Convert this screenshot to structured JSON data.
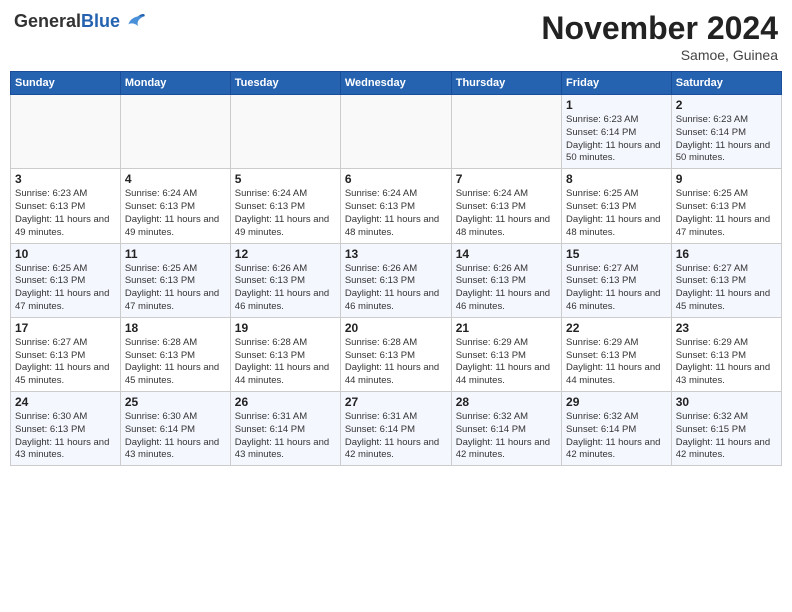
{
  "logo": {
    "general": "General",
    "blue": "Blue"
  },
  "header": {
    "month": "November 2024",
    "location": "Samoe, Guinea"
  },
  "weekdays": [
    "Sunday",
    "Monday",
    "Tuesday",
    "Wednesday",
    "Thursday",
    "Friday",
    "Saturday"
  ],
  "weeks": [
    [
      {
        "day": "",
        "info": ""
      },
      {
        "day": "",
        "info": ""
      },
      {
        "day": "",
        "info": ""
      },
      {
        "day": "",
        "info": ""
      },
      {
        "day": "",
        "info": ""
      },
      {
        "day": "1",
        "info": "Sunrise: 6:23 AM\nSunset: 6:14 PM\nDaylight: 11 hours and 50 minutes."
      },
      {
        "day": "2",
        "info": "Sunrise: 6:23 AM\nSunset: 6:14 PM\nDaylight: 11 hours and 50 minutes."
      }
    ],
    [
      {
        "day": "3",
        "info": "Sunrise: 6:23 AM\nSunset: 6:13 PM\nDaylight: 11 hours and 49 minutes."
      },
      {
        "day": "4",
        "info": "Sunrise: 6:24 AM\nSunset: 6:13 PM\nDaylight: 11 hours and 49 minutes."
      },
      {
        "day": "5",
        "info": "Sunrise: 6:24 AM\nSunset: 6:13 PM\nDaylight: 11 hours and 49 minutes."
      },
      {
        "day": "6",
        "info": "Sunrise: 6:24 AM\nSunset: 6:13 PM\nDaylight: 11 hours and 48 minutes."
      },
      {
        "day": "7",
        "info": "Sunrise: 6:24 AM\nSunset: 6:13 PM\nDaylight: 11 hours and 48 minutes."
      },
      {
        "day": "8",
        "info": "Sunrise: 6:25 AM\nSunset: 6:13 PM\nDaylight: 11 hours and 48 minutes."
      },
      {
        "day": "9",
        "info": "Sunrise: 6:25 AM\nSunset: 6:13 PM\nDaylight: 11 hours and 47 minutes."
      }
    ],
    [
      {
        "day": "10",
        "info": "Sunrise: 6:25 AM\nSunset: 6:13 PM\nDaylight: 11 hours and 47 minutes."
      },
      {
        "day": "11",
        "info": "Sunrise: 6:25 AM\nSunset: 6:13 PM\nDaylight: 11 hours and 47 minutes."
      },
      {
        "day": "12",
        "info": "Sunrise: 6:26 AM\nSunset: 6:13 PM\nDaylight: 11 hours and 46 minutes."
      },
      {
        "day": "13",
        "info": "Sunrise: 6:26 AM\nSunset: 6:13 PM\nDaylight: 11 hours and 46 minutes."
      },
      {
        "day": "14",
        "info": "Sunrise: 6:26 AM\nSunset: 6:13 PM\nDaylight: 11 hours and 46 minutes."
      },
      {
        "day": "15",
        "info": "Sunrise: 6:27 AM\nSunset: 6:13 PM\nDaylight: 11 hours and 46 minutes."
      },
      {
        "day": "16",
        "info": "Sunrise: 6:27 AM\nSunset: 6:13 PM\nDaylight: 11 hours and 45 minutes."
      }
    ],
    [
      {
        "day": "17",
        "info": "Sunrise: 6:27 AM\nSunset: 6:13 PM\nDaylight: 11 hours and 45 minutes."
      },
      {
        "day": "18",
        "info": "Sunrise: 6:28 AM\nSunset: 6:13 PM\nDaylight: 11 hours and 45 minutes."
      },
      {
        "day": "19",
        "info": "Sunrise: 6:28 AM\nSunset: 6:13 PM\nDaylight: 11 hours and 44 minutes."
      },
      {
        "day": "20",
        "info": "Sunrise: 6:28 AM\nSunset: 6:13 PM\nDaylight: 11 hours and 44 minutes."
      },
      {
        "day": "21",
        "info": "Sunrise: 6:29 AM\nSunset: 6:13 PM\nDaylight: 11 hours and 44 minutes."
      },
      {
        "day": "22",
        "info": "Sunrise: 6:29 AM\nSunset: 6:13 PM\nDaylight: 11 hours and 44 minutes."
      },
      {
        "day": "23",
        "info": "Sunrise: 6:29 AM\nSunset: 6:13 PM\nDaylight: 11 hours and 43 minutes."
      }
    ],
    [
      {
        "day": "24",
        "info": "Sunrise: 6:30 AM\nSunset: 6:13 PM\nDaylight: 11 hours and 43 minutes."
      },
      {
        "day": "25",
        "info": "Sunrise: 6:30 AM\nSunset: 6:14 PM\nDaylight: 11 hours and 43 minutes."
      },
      {
        "day": "26",
        "info": "Sunrise: 6:31 AM\nSunset: 6:14 PM\nDaylight: 11 hours and 43 minutes."
      },
      {
        "day": "27",
        "info": "Sunrise: 6:31 AM\nSunset: 6:14 PM\nDaylight: 11 hours and 42 minutes."
      },
      {
        "day": "28",
        "info": "Sunrise: 6:32 AM\nSunset: 6:14 PM\nDaylight: 11 hours and 42 minutes."
      },
      {
        "day": "29",
        "info": "Sunrise: 6:32 AM\nSunset: 6:14 PM\nDaylight: 11 hours and 42 minutes."
      },
      {
        "day": "30",
        "info": "Sunrise: 6:32 AM\nSunset: 6:15 PM\nDaylight: 11 hours and 42 minutes."
      }
    ]
  ]
}
